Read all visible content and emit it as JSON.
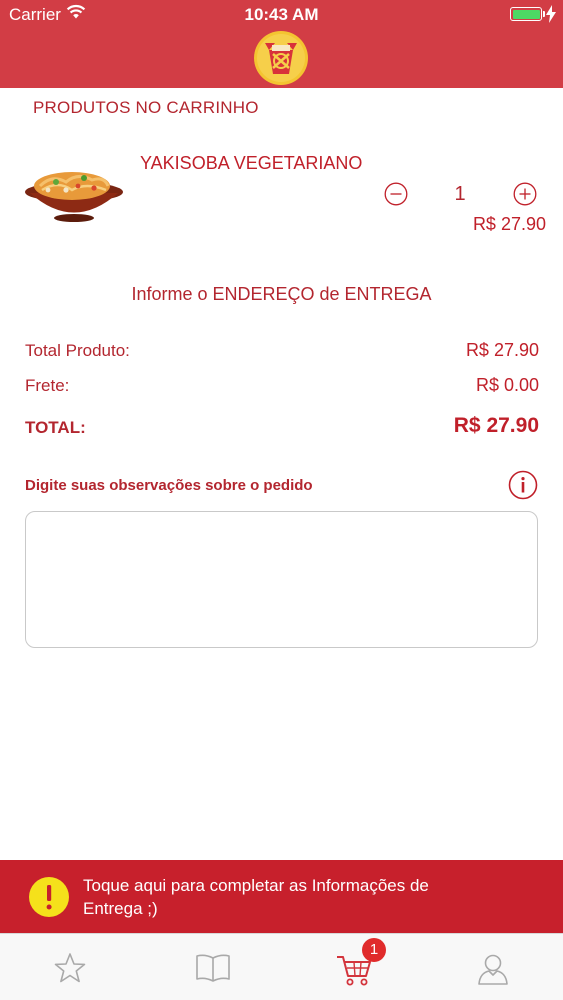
{
  "status_bar": {
    "carrier": "Carrier",
    "time": "10:43 AM"
  },
  "header": {
    "logo_icon": "noodle-box-logo"
  },
  "cart": {
    "title": "PRODUTOS NO CARRINHO",
    "items": [
      {
        "name": "YAKISOBA VEGETARIANO",
        "quantity": "1",
        "price": "R$ 27.90",
        "image": "yakisoba-bowl-image"
      }
    ]
  },
  "delivery": {
    "address_prompt": "Informe o ENDEREÇO de ENTREGA"
  },
  "summary": {
    "product_total_label": "Total Produto:",
    "product_total_value": "R$ 27.90",
    "shipping_label": "Frete:",
    "shipping_value": "R$ 0.00",
    "total_label": "TOTAL:",
    "total_value": "R$ 27.90"
  },
  "observations": {
    "label": "Digite suas observações sobre o pedido",
    "value": "",
    "placeholder": ""
  },
  "banner": {
    "text": "Toque aqui para completar as Informações de Entrega ;)"
  },
  "tabbar": {
    "items": [
      {
        "icon": "star-icon"
      },
      {
        "icon": "book-icon"
      },
      {
        "icon": "cart-icon",
        "badge": "1"
      },
      {
        "icon": "user-icon"
      }
    ]
  },
  "colors": {
    "header": "#d23d45",
    "accent": "#c0202a",
    "banner": "#c7202c",
    "warning": "#f5e11b",
    "badge": "#e02b2b"
  }
}
